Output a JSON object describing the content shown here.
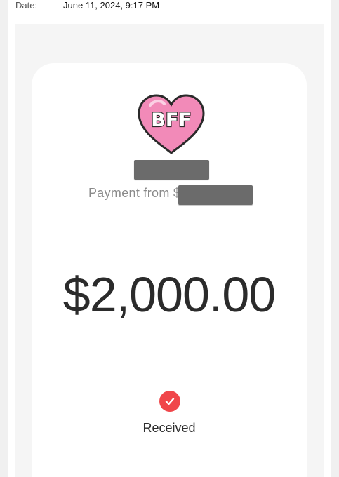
{
  "header": {
    "date_label": "Date:",
    "date_value": "June 11, 2024, 9:17 PM"
  },
  "card": {
    "avatar": {
      "text": "BFF",
      "icon": "heart-bff-avatar",
      "color": "#f28ab8"
    },
    "payment_from_label": "Payment from $",
    "amount": "$2,000.00",
    "status": {
      "label": "Received",
      "icon": "check-icon",
      "color": "#f0464a"
    }
  }
}
